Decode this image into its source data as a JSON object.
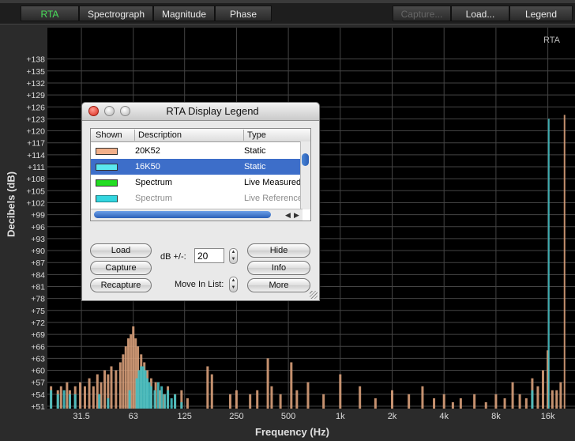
{
  "toolbar": {
    "tabs": [
      {
        "label": "RTA",
        "active": true
      },
      {
        "label": "Spectrograph",
        "active": false
      },
      {
        "label": "Magnitude",
        "active": false
      },
      {
        "label": "Phase",
        "active": false
      }
    ],
    "capture_label": "Capture...",
    "load_label": "Load...",
    "legend_label": "Legend"
  },
  "plot": {
    "corner_label": "RTA",
    "ylabel": "Decibels (dB)",
    "xlabel": "Frequency (Hz)",
    "ylim": [
      51,
      140
    ],
    "xlim_hz": [
      20,
      23000
    ],
    "y_ticks": [
      "+138",
      "+135",
      "+132",
      "+129",
      "+126",
      "+123",
      "+120",
      "+117",
      "+114",
      "+111",
      "+108",
      "+105",
      "+102",
      "+99",
      "+96",
      "+93",
      "+90",
      "+87",
      "+84",
      "+81",
      "+78",
      "+75",
      "+72",
      "+69",
      "+66",
      "+63",
      "+60",
      "+57",
      "+54",
      "+51"
    ],
    "x_ticks": [
      {
        "label": "31.5",
        "hz": 31.5
      },
      {
        "label": "63",
        "hz": 63
      },
      {
        "label": "125",
        "hz": 125
      },
      {
        "label": "250",
        "hz": 250
      },
      {
        "label": "500",
        "hz": 500
      },
      {
        "label": "1k",
        "hz": 1000
      },
      {
        "label": "2k",
        "hz": 2000
      },
      {
        "label": "4k",
        "hz": 4000
      },
      {
        "label": "8k",
        "hz": 8000
      },
      {
        "label": "16k",
        "hz": 16000
      }
    ],
    "colors": {
      "background": "#000000",
      "grid": "#444444",
      "tan": "#d9a07a",
      "teal": "#45bfc2"
    }
  },
  "chart_data": {
    "type": "bar",
    "series": [
      {
        "name": "20K52",
        "color": "#d9a07a",
        "points": [
          [
            21,
            56
          ],
          [
            23,
            55
          ],
          [
            24,
            56
          ],
          [
            26,
            57
          ],
          [
            27,
            55
          ],
          [
            29,
            56
          ],
          [
            31,
            57
          ],
          [
            33,
            56
          ],
          [
            35,
            58
          ],
          [
            37,
            56
          ],
          [
            39,
            59
          ],
          [
            41,
            57
          ],
          [
            43,
            60
          ],
          [
            45,
            59
          ],
          [
            47,
            61
          ],
          [
            50,
            60
          ],
          [
            53,
            62
          ],
          [
            55,
            64
          ],
          [
            57,
            66
          ],
          [
            59,
            68
          ],
          [
            61,
            69
          ],
          [
            63,
            71
          ],
          [
            65,
            68
          ],
          [
            67,
            66
          ],
          [
            70,
            64
          ],
          [
            73,
            62
          ],
          [
            76,
            60
          ],
          [
            80,
            58
          ],
          [
            85,
            57
          ],
          [
            90,
            55
          ],
          [
            95,
            54
          ],
          [
            100,
            56
          ],
          [
            110,
            54
          ],
          [
            120,
            55
          ],
          [
            130,
            53
          ],
          [
            170,
            61
          ],
          [
            180,
            59
          ],
          [
            230,
            54
          ],
          [
            250,
            55
          ],
          [
            300,
            54
          ],
          [
            330,
            55
          ],
          [
            380,
            63
          ],
          [
            400,
            56
          ],
          [
            450,
            54
          ],
          [
            520,
            62
          ],
          [
            560,
            55
          ],
          [
            650,
            57
          ],
          [
            800,
            54
          ],
          [
            1000,
            59
          ],
          [
            1300,
            56
          ],
          [
            1600,
            53
          ],
          [
            2000,
            55
          ],
          [
            2500,
            54
          ],
          [
            3000,
            56
          ],
          [
            3500,
            53
          ],
          [
            4000,
            54
          ],
          [
            4500,
            52
          ],
          [
            5000,
            53
          ],
          [
            6000,
            54
          ],
          [
            7000,
            52
          ],
          [
            8000,
            54
          ],
          [
            9000,
            53
          ],
          [
            10000,
            57
          ],
          [
            11000,
            54
          ],
          [
            12000,
            53
          ],
          [
            13000,
            58
          ],
          [
            14000,
            56
          ],
          [
            15000,
            60
          ],
          [
            16000,
            65
          ],
          [
            17000,
            55
          ],
          [
            18000,
            55
          ],
          [
            19000,
            57
          ],
          [
            20000,
            124
          ]
        ]
      },
      {
        "name": "16K50",
        "color": "#45bfc2",
        "points": [
          [
            21,
            55
          ],
          [
            23,
            54
          ],
          [
            25,
            55
          ],
          [
            27,
            54
          ],
          [
            29,
            54
          ],
          [
            40,
            54
          ],
          [
            45,
            53
          ],
          [
            60,
            55
          ],
          [
            66,
            58
          ],
          [
            68,
            60
          ],
          [
            70,
            61
          ],
          [
            72,
            61
          ],
          [
            74,
            60
          ],
          [
            76,
            58
          ],
          [
            78,
            57
          ],
          [
            80,
            56
          ],
          [
            84,
            55
          ],
          [
            88,
            57
          ],
          [
            92,
            56
          ],
          [
            96,
            54
          ],
          [
            100,
            55
          ],
          [
            105,
            53
          ],
          [
            110,
            54
          ],
          [
            120,
            52
          ],
          [
            13000,
            55
          ],
          [
            16200,
            123
          ]
        ]
      }
    ]
  },
  "legend_window": {
    "title": "RTA Display Legend",
    "columns": [
      "Shown",
      "Description",
      "Type"
    ],
    "rows": [
      {
        "description": "20K52",
        "type": "Static",
        "swatch": "#f2b08a",
        "selected": false,
        "dimmed": false
      },
      {
        "description": "16K50",
        "type": "Static",
        "swatch": "#5be8f0",
        "selected": true,
        "dimmed": false
      },
      {
        "description": "Spectrum",
        "type": "Live Measured",
        "swatch": "#22dd22",
        "selected": false,
        "dimmed": false
      },
      {
        "description": "Spectrum",
        "type": "Live Reference",
        "swatch": "#33d6e0",
        "selected": false,
        "dimmed": true
      }
    ],
    "load_label": "Load",
    "capture_label": "Capture",
    "recapture_label": "Recapture",
    "db_label": "dB +/-:",
    "db_value": "20",
    "move_label": "Move In List:",
    "hide_label": "Hide",
    "info_label": "Info",
    "more_label": "More"
  }
}
